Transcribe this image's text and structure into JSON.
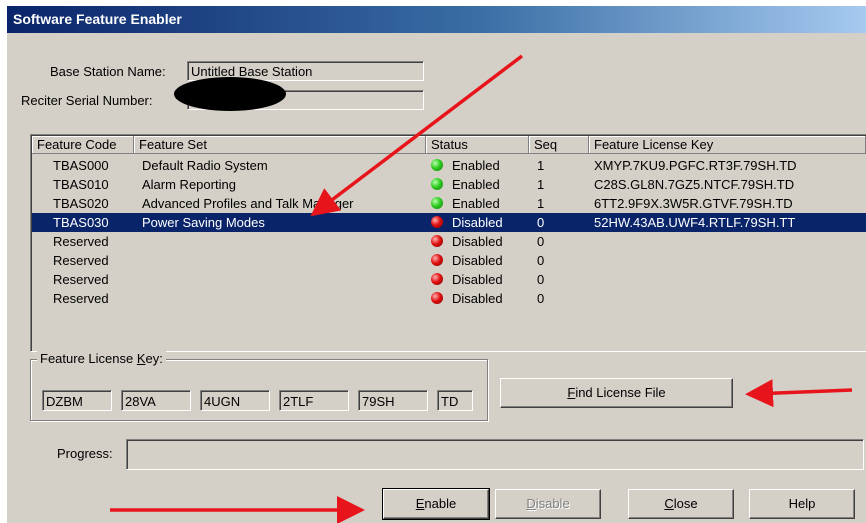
{
  "window": {
    "title": "Software Feature Enabler"
  },
  "base_station": {
    "label": "Base Station Name:",
    "value": "Untitled Base Station"
  },
  "reciter": {
    "label": "Reciter Serial Number:",
    "value": ""
  },
  "table": {
    "columns": [
      "Feature Code",
      "Feature Set",
      "Status",
      "Seq",
      "Feature License Key"
    ],
    "rows": [
      {
        "code": "TBAS000",
        "set": "Default Radio System",
        "status": "Enabled",
        "seq": "1",
        "key": "XMYP.7KU9.PGFC.RT3F.79SH.TD"
      },
      {
        "code": "TBAS010",
        "set": "Alarm Reporting",
        "status": "Enabled",
        "seq": "1",
        "key": "C28S.GL8N.7GZ5.NTCF.79SH.TD"
      },
      {
        "code": "TBAS020",
        "set": "Advanced Profiles and Talk Manager",
        "status": "Enabled",
        "seq": "1",
        "key": "6TT2.9F9X.3W5R.GTVF.79SH.TD"
      },
      {
        "code": "TBAS030",
        "set": "Power Saving Modes",
        "status": "Disabled",
        "seq": "0",
        "key": "52HW.43AB.UWF4.RTLF.79SH.TT"
      },
      {
        "code": "Reserved",
        "set": "",
        "status": "Disabled",
        "seq": "0",
        "key": ""
      },
      {
        "code": "Reserved",
        "set": "",
        "status": "Disabled",
        "seq": "0",
        "key": ""
      },
      {
        "code": "Reserved",
        "set": "",
        "status": "Disabled",
        "seq": "0",
        "key": ""
      },
      {
        "code": "Reserved",
        "set": "",
        "status": "Disabled",
        "seq": "0",
        "key": ""
      }
    ]
  },
  "license_key": {
    "legend_prefix": "Feature License ",
    "legend_accel": "K",
    "legend_suffix": "ey:",
    "parts": [
      "DZBM",
      "28VA",
      "4UGN",
      "2TLF",
      "79SH",
      "TD"
    ]
  },
  "find_button": {
    "accel": "F",
    "rest": "ind License File"
  },
  "progress": {
    "label": "Progress:"
  },
  "buttons": {
    "enable": {
      "accel": "E",
      "rest": "nable"
    },
    "disable": {
      "accel": "D",
      "rest": "isable"
    },
    "close": {
      "accel": "C",
      "rest": "lose"
    },
    "help": "Help"
  },
  "colors": {
    "enabled_dot": "#2ecc1f",
    "disabled_dot": "#e01010",
    "selection": "#0a246a",
    "arrow": "#e8141b"
  }
}
